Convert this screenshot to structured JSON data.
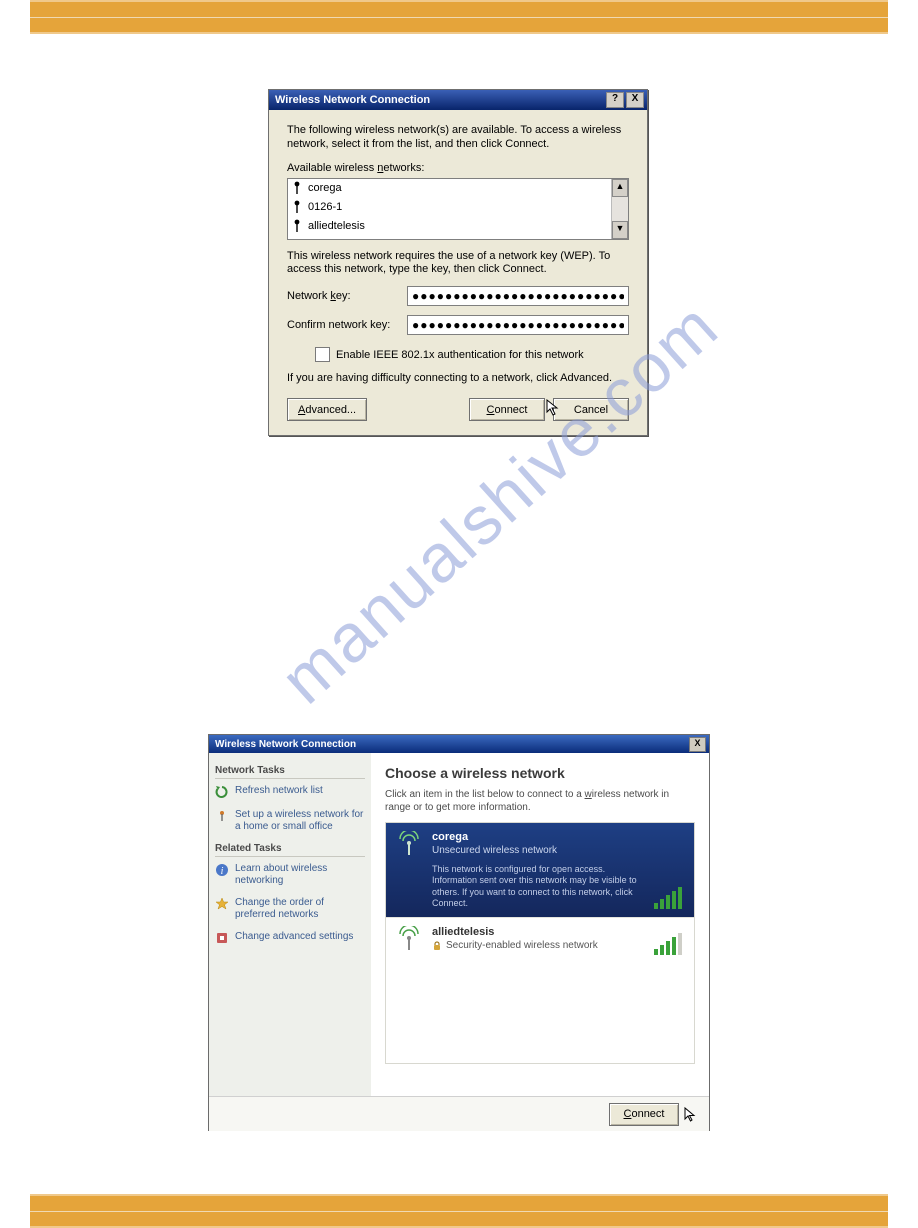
{
  "watermark": "manualshive.com",
  "dialog1": {
    "title": "Wireless Network Connection",
    "help_btn": "?",
    "close_btn": "X",
    "instruction": "The following wireless network(s) are available. To access a wireless network, select it from the list, and then click Connect.",
    "list_label": "Available wireless networks:",
    "networks": [
      "corega",
      "0126-1",
      "alliedtelesis"
    ],
    "scroll_up": "▲",
    "scroll_down": "▼",
    "key_info": "This wireless network requires the use of a network key (WEP). To access this network, type the key, then click Connect.",
    "key_label": "Network key:",
    "confirm_key_label": "Confirm network key:",
    "key_value": "●●●●●●●●●●●●●●●●●●●●●●●●●●",
    "confirm_key_value": "●●●●●●●●●●●●●●●●●●●●●●●●●●",
    "enable_8021x": "Enable IEEE 802.1x authentication for this network",
    "advanced_info": "If you are having difficulty connecting to a network, click Advanced.",
    "advanced_btn": "Advanced...",
    "connect_btn": "Connect",
    "cancel_btn": "Cancel"
  },
  "dialog2": {
    "title": "Wireless Network Connection",
    "close_btn": "X",
    "heading": "Choose a wireless network",
    "sub_instruction": "Click an item in the list below to connect to a wireless network in range or to get more information.",
    "sidebar": {
      "section1": "Network Tasks",
      "refresh": "Refresh network list",
      "setup": "Set up a wireless network for a home or small office",
      "section2": "Related Tasks",
      "learn": "Learn about wireless networking",
      "order": "Change the order of preferred networks",
      "advanced": "Change advanced settings"
    },
    "net_selected": {
      "ssid": "corega",
      "subtitle": "Unsecured wireless network",
      "detail": "This network is configured for open access. Information sent over this network may be visible to others. If you want to connect to this network, click Connect."
    },
    "net_other": {
      "ssid": "alliedtelesis",
      "subtitle": "Security-enabled wireless network"
    },
    "connect_btn": "Connect"
  }
}
